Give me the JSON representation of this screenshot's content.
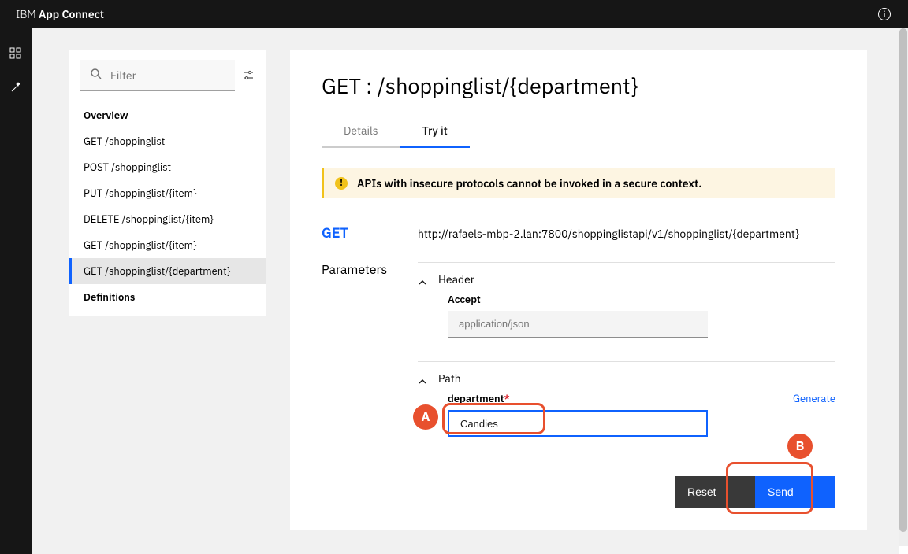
{
  "topbar": {
    "title_light": "IBM ",
    "title_bold": "App Connect"
  },
  "filter": {
    "placeholder": "Filter"
  },
  "nav": {
    "overview": "Overview",
    "items": [
      "GET /shoppinglist",
      "POST /shoppinglist",
      "PUT /shoppinglist/{item}",
      "DELETE /shoppinglist/{item}",
      "GET /shoppinglist/{item}",
      "GET /shoppinglist/{department}"
    ],
    "definitions": "Definitions"
  },
  "page": {
    "title": "GET : /shoppinglist/{department}",
    "tab_details": "Details",
    "tab_tryit": "Try it"
  },
  "alert": {
    "text": "APIs with insecure protocols cannot be invoked in a secure context."
  },
  "endpoint": {
    "method": "GET",
    "url": "http://rafaels-mbp-2.lan:7800/shoppinglistapi/v1/shoppinglist/{department}"
  },
  "params": {
    "section_label": "Parameters",
    "header_title": "Header",
    "accept_label": "Accept",
    "accept_placeholder": "application/json",
    "path_title": "Path",
    "department_label": "department",
    "generate_label": "Generate",
    "department_value": "Candies"
  },
  "buttons": {
    "reset": "Reset",
    "send": "Send"
  },
  "annotations": {
    "a": "A",
    "b": "B"
  }
}
